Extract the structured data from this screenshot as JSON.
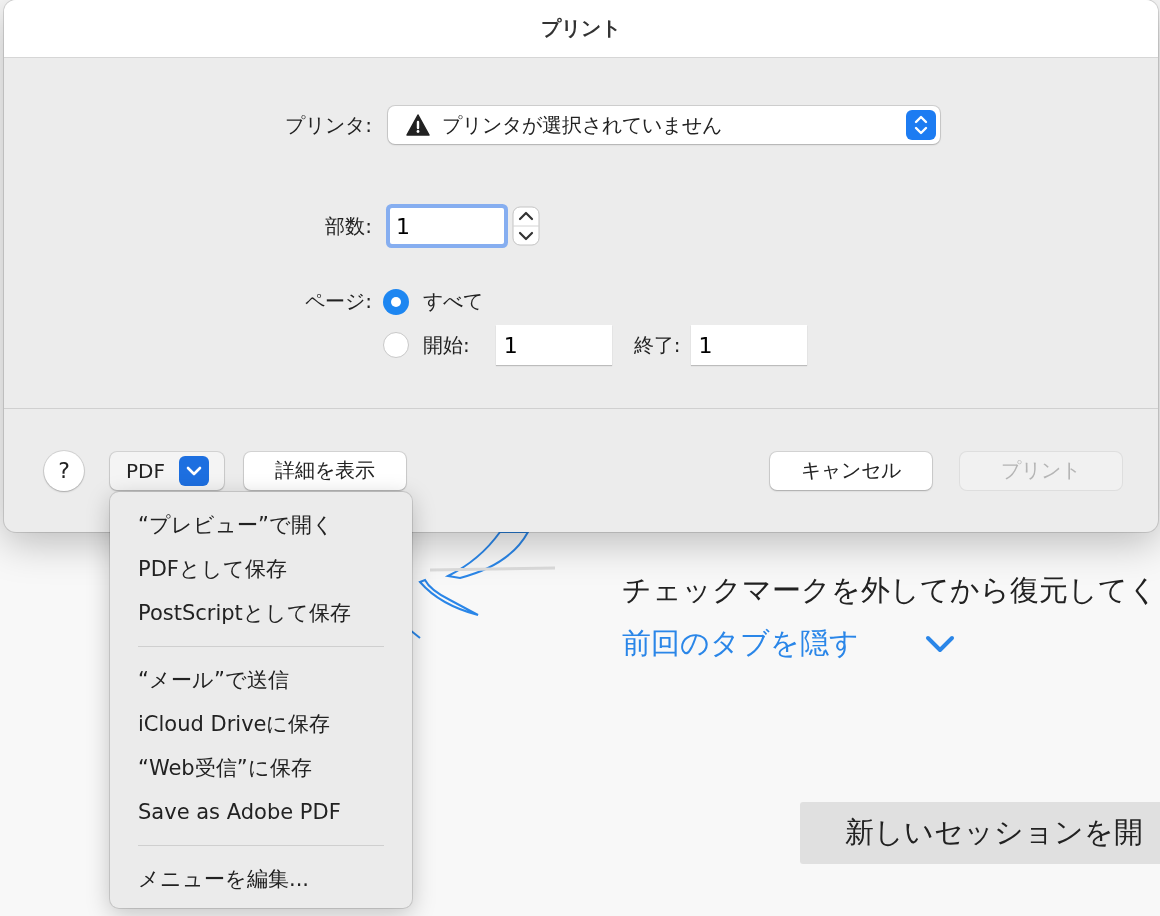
{
  "background": {
    "text_line": "チェックマークを外してから復元してく",
    "link": "前回のタブを隠す",
    "new_session_button": "新しいセッションを開"
  },
  "dialog": {
    "title": "プリント",
    "printer": {
      "label": "プリンタ:",
      "value": "プリンタが選択されていません",
      "warning": true
    },
    "copies": {
      "label": "部数:",
      "value": "1",
      "focused": true
    },
    "pages": {
      "label": "ページ:",
      "options": [
        {
          "kind": "all",
          "label": "すべて",
          "selected": true
        },
        {
          "kind": "range",
          "label": "開始:",
          "selected": false,
          "from": "1",
          "to_label": "終了:",
          "to": "1"
        }
      ]
    },
    "help_button": "?",
    "pdf_button": {
      "label": "PDF",
      "expanded": true
    },
    "details_button": "詳細を表示",
    "cancel_button": "キャンセル",
    "print_button": {
      "label": "プリント",
      "disabled": true
    }
  },
  "pdf_menu": {
    "groups": [
      [
        "“プレビュー”で開く",
        "PDFとして保存",
        "PostScriptとして保存"
      ],
      [
        "“メール”で送信",
        "iCloud Driveに保存",
        "“Web受信”に保存",
        "Save as Adobe PDF"
      ],
      [
        "メニューを編集..."
      ]
    ]
  }
}
